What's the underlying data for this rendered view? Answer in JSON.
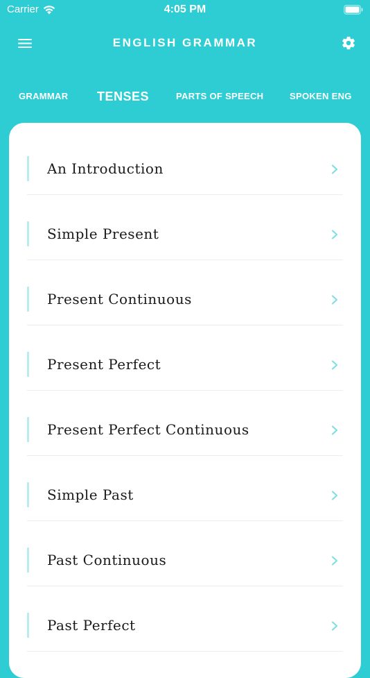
{
  "status_bar": {
    "carrier": "Carrier",
    "time": "4:05 PM"
  },
  "header": {
    "title": "ENGLISH GRAMMAR",
    "menu_icon": "hamburger-menu-icon",
    "settings_icon": "gear-icon"
  },
  "tabs": [
    {
      "label": "GRAMMAR",
      "active": false
    },
    {
      "label": "TENSES",
      "active": true
    },
    {
      "label": "PARTS OF SPEECH",
      "active": false
    },
    {
      "label": "SPOKEN ENG",
      "active": false
    }
  ],
  "list": {
    "items": [
      {
        "label": "An Introduction"
      },
      {
        "label": "Simple Present"
      },
      {
        "label": "Present Continuous"
      },
      {
        "label": "Present Perfect"
      },
      {
        "label": "Present Perfect Continuous"
      },
      {
        "label": "Simple Past"
      },
      {
        "label": "Past Continuous"
      },
      {
        "label": "Past Perfect"
      }
    ]
  },
  "colors": {
    "brand": "#2ecdd3",
    "accent_bar": "#b8ecee",
    "chevron": "#7fdfe3",
    "card": "#ffffff",
    "text": "#1a1a1a"
  }
}
